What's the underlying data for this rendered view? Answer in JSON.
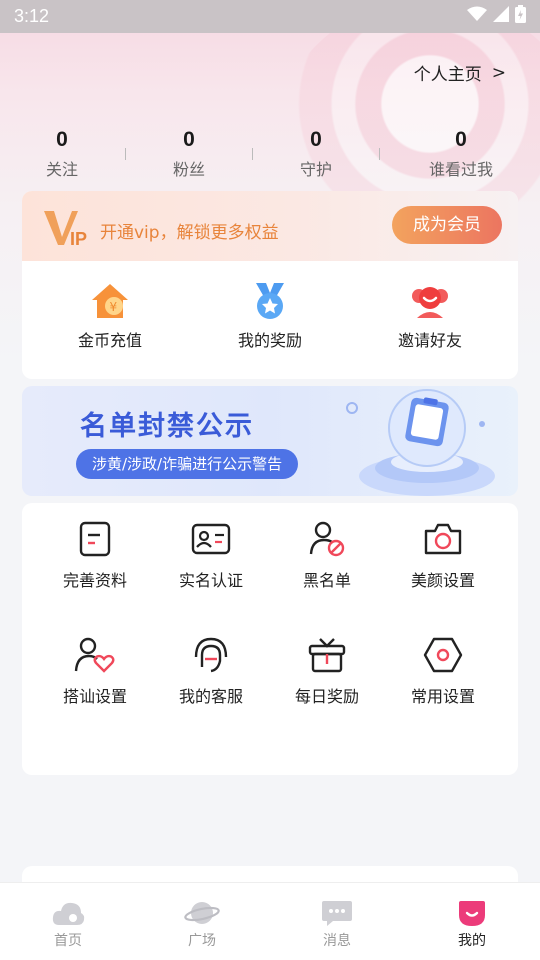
{
  "status_bar": {
    "time": "3:12"
  },
  "header": {
    "profile_link": "个人主页",
    "profile_arrow": ">"
  },
  "stats": [
    {
      "value": "0",
      "label": "关注"
    },
    {
      "value": "0",
      "label": "粉丝"
    },
    {
      "value": "0",
      "label": "守护"
    },
    {
      "value": "0",
      "label": "谁看过我"
    }
  ],
  "vip": {
    "promo_text": "开通vip，解锁更多权益",
    "button_label": "成为会员",
    "accent": "#e8843b"
  },
  "quick_actions": [
    {
      "label": "金币充值",
      "icon": "coin-house-icon"
    },
    {
      "label": "我的奖励",
      "icon": "medal-icon"
    },
    {
      "label": "邀请好友",
      "icon": "invite-friend-icon"
    }
  ],
  "ban_banner": {
    "title": "名单封禁公示",
    "subtitle": "涉黄/涉政/诈骗进行公示警告"
  },
  "tools": [
    {
      "label": "完善资料",
      "icon": "profile-card-icon"
    },
    {
      "label": "实名认证",
      "icon": "id-card-icon"
    },
    {
      "label": "黑名单",
      "icon": "blocked-user-icon"
    },
    {
      "label": "美颜设置",
      "icon": "camera-icon"
    },
    {
      "label": "搭讪设置",
      "icon": "user-heart-icon"
    },
    {
      "label": "我的客服",
      "icon": "headset-icon"
    },
    {
      "label": "每日奖励",
      "icon": "gift-icon"
    },
    {
      "label": "常用设置",
      "icon": "settings-hexagon-icon"
    }
  ],
  "tabbar": [
    {
      "label": "首页",
      "icon": "home-cloud-icon"
    },
    {
      "label": "广场",
      "icon": "planet-icon"
    },
    {
      "label": "消息",
      "icon": "message-icon"
    },
    {
      "label": "我的",
      "icon": "me-icon"
    }
  ],
  "colors": {
    "brand_pink": "#ec3b7a",
    "link_blue": "#3a5bd8"
  }
}
